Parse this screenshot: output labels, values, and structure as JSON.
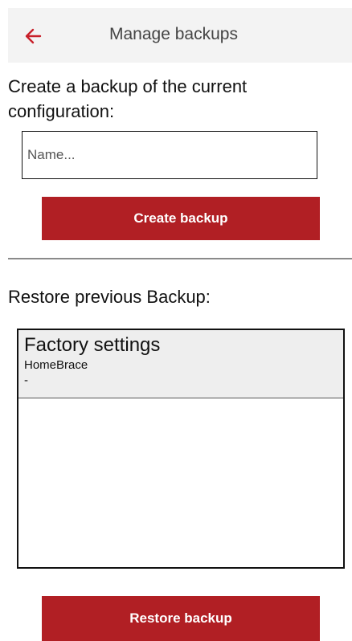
{
  "header": {
    "title": "Manage backups",
    "back_icon": "arrow-left-icon",
    "accent_color": "#b11f24"
  },
  "create": {
    "heading": "Create a backup of the current configuration:",
    "name_placeholder": "Name...",
    "name_value": "",
    "button_label": "Create backup"
  },
  "restore": {
    "heading": "Restore previous Backup:",
    "items": [
      {
        "name": "Factory settings",
        "device": "HomeBrace",
        "date": "-"
      }
    ],
    "button_label": "Restore backup"
  },
  "colors": {
    "primary_button": "#b11f24",
    "header_background": "#f3f3f3",
    "list_item_background": "#eeeeee"
  }
}
